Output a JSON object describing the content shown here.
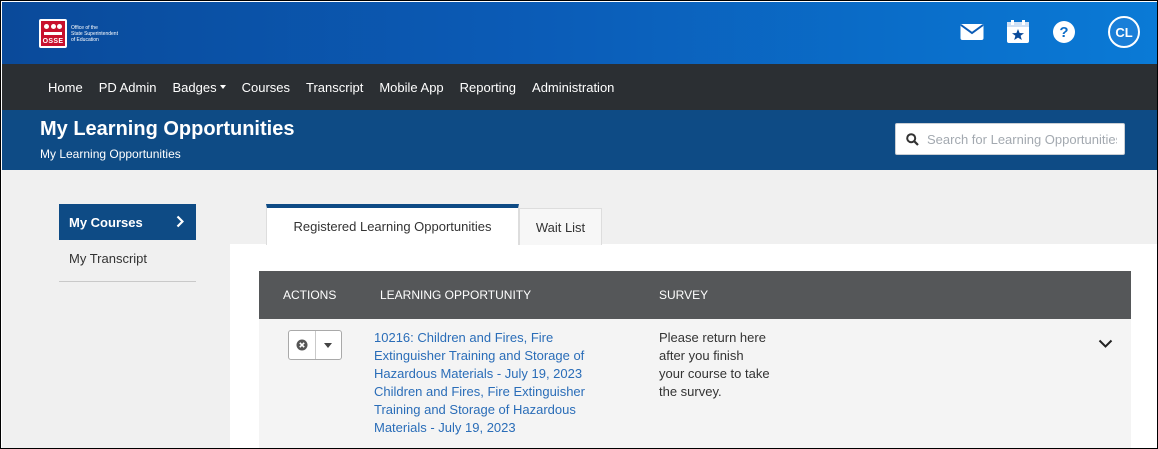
{
  "brand": {
    "logo_text": "OSSE",
    "org_lines": [
      "Office of the",
      "State Superintendent",
      "of Education"
    ]
  },
  "topbar": {
    "icons": [
      "mail-icon",
      "calendar-star-icon",
      "help-icon"
    ],
    "avatar_initials": "CL"
  },
  "nav": {
    "items": [
      "Home",
      "PD Admin",
      "Badges",
      "Courses",
      "Transcript",
      "Mobile App",
      "Reporting",
      "Administration"
    ]
  },
  "header": {
    "title": "My Learning Opportunities",
    "subtitle": "My Learning Opportunities",
    "search_placeholder": "Search for Learning Opportunities"
  },
  "sidebar": {
    "active_label": "My Courses",
    "item_label": "My Transcript"
  },
  "tabs": {
    "active_label": "Registered Learning Opportunities",
    "inactive_label": "Wait List"
  },
  "table": {
    "headers": {
      "actions": "ACTIONS",
      "learning_opportunity": "LEARNING OPPORTUNITY",
      "survey": "SURVEY"
    },
    "rows": [
      {
        "learning_opportunity_lines": [
          "10216: Children and Fires, Fire",
          "Extinguisher Training and Storage of",
          "Hazardous Materials - July 19, 2023",
          "Children and Fires, Fire Extinguisher",
          "Training and Storage of Hazardous",
          "Materials - July 19, 2023"
        ],
        "survey_lines": [
          "Please return here",
          "after you finish",
          "your course to take",
          "the survey."
        ]
      }
    ]
  },
  "colors": {
    "brand_blue": "#0e4b85",
    "nav_dark": "#2b2f33",
    "link_blue": "#2a6db8",
    "table_header": "#555759",
    "logo_red": "#c8102e"
  }
}
